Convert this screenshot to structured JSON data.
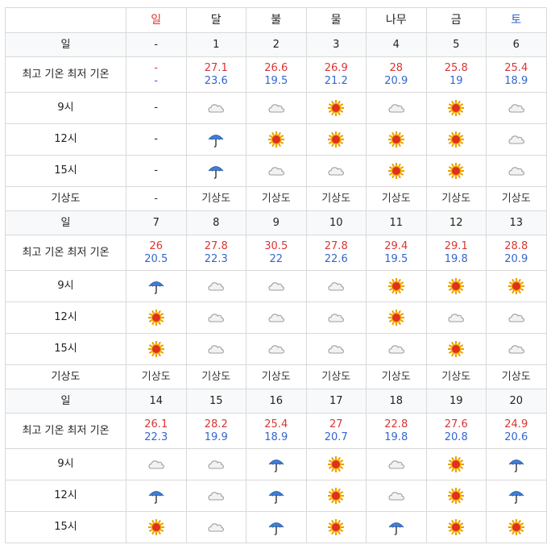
{
  "header": {
    "days": [
      {
        "label": "일",
        "color": "sun"
      },
      {
        "label": "달",
        "color": ""
      },
      {
        "label": "불",
        "color": ""
      },
      {
        "label": "물",
        "color": ""
      },
      {
        "label": "나무",
        "color": ""
      },
      {
        "label": "금",
        "color": ""
      },
      {
        "label": "토",
        "color": "sat"
      }
    ]
  },
  "labels": {
    "day": "일",
    "temp": "최고 기온 최저 기온",
    "h9": "9시",
    "h12": "12시",
    "h15": "15시",
    "link": "기상도"
  },
  "weeks": [
    {
      "days": [
        "-",
        "1",
        "2",
        "3",
        "4",
        "5",
        "6"
      ],
      "hi": [
        "-",
        "27.1",
        "26.6",
        "26.9",
        "28",
        "25.8",
        "25.4"
      ],
      "lo": [
        "-",
        "23.6",
        "19.5",
        "21.2",
        "20.9",
        "19",
        "18.9"
      ],
      "h9": [
        "none",
        "cloud",
        "cloud",
        "sun",
        "cloud",
        "sun",
        "cloud"
      ],
      "h12": [
        "none",
        "umbrella",
        "sun",
        "sun",
        "sun",
        "sun",
        "cloud"
      ],
      "h15": [
        "none",
        "umbrella",
        "cloud",
        "cloud",
        "sun",
        "sun",
        "cloud"
      ],
      "link": [
        "-",
        "기상도",
        "기상도",
        "기상도",
        "기상도",
        "기상도",
        "기상도"
      ]
    },
    {
      "days": [
        "7",
        "8",
        "9",
        "10",
        "11",
        "12",
        "13"
      ],
      "hi": [
        "26",
        "27.8",
        "30.5",
        "27.8",
        "29.4",
        "29.1",
        "28.8"
      ],
      "lo": [
        "20.5",
        "22.3",
        "22",
        "22.6",
        "19.5",
        "19.8",
        "20.9"
      ],
      "h9": [
        "umbrella",
        "cloud",
        "cloud",
        "cloud",
        "sun",
        "sun",
        "sun"
      ],
      "h12": [
        "sun",
        "cloud",
        "cloud",
        "cloud",
        "sun",
        "cloud",
        "cloud"
      ],
      "h15": [
        "sun",
        "cloud",
        "cloud",
        "cloud",
        "cloud",
        "sun",
        "cloud"
      ],
      "link": [
        "기상도",
        "기상도",
        "기상도",
        "기상도",
        "기상도",
        "기상도",
        "기상도"
      ]
    },
    {
      "days": [
        "14",
        "15",
        "16",
        "17",
        "18",
        "19",
        "20"
      ],
      "hi": [
        "26.1",
        "28.2",
        "25.4",
        "27",
        "22.8",
        "27.6",
        "24.9"
      ],
      "lo": [
        "22.3",
        "19.9",
        "18.9",
        "20.7",
        "19.8",
        "20.8",
        "20.6"
      ],
      "h9": [
        "cloud",
        "cloud",
        "umbrella",
        "sun",
        "cloud",
        "sun",
        "umbrella"
      ],
      "h12": [
        "umbrella",
        "cloud",
        "umbrella",
        "sun",
        "cloud",
        "sun",
        "umbrella"
      ],
      "h15": [
        "sun",
        "cloud",
        "umbrella",
        "sun",
        "umbrella",
        "sun",
        "sun"
      ]
    }
  ],
  "none_text": "-"
}
